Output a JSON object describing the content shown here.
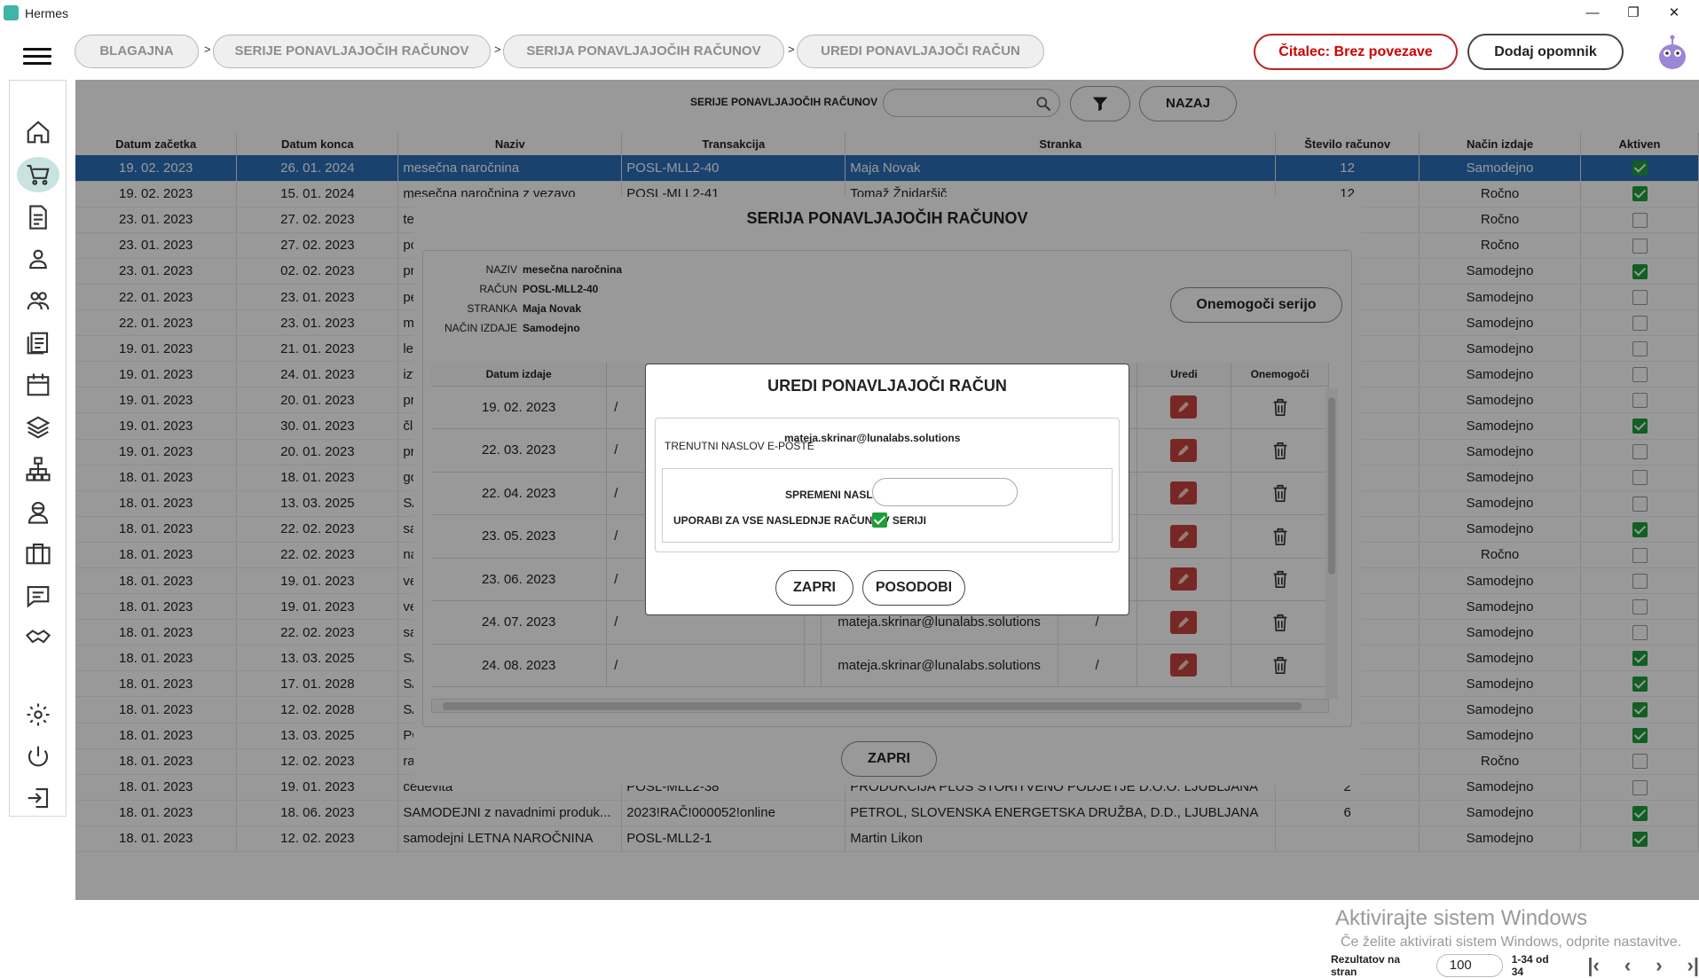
{
  "window": {
    "title": "Hermes",
    "minimize": "—",
    "maximize": "❐",
    "close": "✕"
  },
  "breadcrumbs": [
    "BLAGAJNA",
    "SERIJE PONAVLJAJOČIH RAČUNOV",
    "SERIJA PONAVLJAJOČIH RAČUNOV",
    "UREDI PONAVLJAJOČI RAČUN"
  ],
  "breadcrumb_separator": ">",
  "header": {
    "reader_status": "Čitalec: Brez povezave",
    "add_reminder": "Dodaj opomnik"
  },
  "sidebar": {
    "items": [
      "home-icon",
      "cart-icon",
      "document-icon",
      "user-icon",
      "users-icon",
      "notes-icon",
      "calendar-icon",
      "layers-icon",
      "network-icon",
      "support-icon",
      "briefcase-icon",
      "chat-icon",
      "handshake-icon",
      "settings-icon",
      "power-icon",
      "logout-icon"
    ],
    "active": "cart-icon"
  },
  "toolbar": {
    "filter_label": "SERIJE PONAVLJAJOČIH RAČUNOV",
    "search_placeholder": "",
    "back_label": "NAZAJ"
  },
  "table": {
    "columns": [
      "Datum začetka",
      "Datum konca",
      "Naziv",
      "Transakcija",
      "Stranka",
      "Število računov",
      "Način izdaje",
      "Aktiven"
    ],
    "rows": [
      [
        "19. 02. 2023",
        "26. 01. 2024",
        "mesečna naročnina",
        "POSL-MLL2-40",
        "Maja Novak",
        "12",
        "Samodejno",
        true
      ],
      [
        "19. 02. 2023",
        "15. 01. 2024",
        "mesečna naročnina z vezavo",
        "POSL-MLL2-41",
        "Tomaž Žnidaršič",
        "12",
        "Ročno",
        true
      ],
      [
        "23. 01. 2023",
        "27. 02. 2023",
        "te",
        "",
        "",
        "",
        "Ročno",
        false
      ],
      [
        "23. 01. 2023",
        "27. 02. 2023",
        "po",
        "",
        "",
        "",
        "Ročno",
        false
      ],
      [
        "23. 01. 2023",
        "02. 02. 2023",
        "pr",
        "",
        "",
        "",
        "Samodejno",
        true
      ],
      [
        "22. 01. 2023",
        "23. 01. 2023",
        "pe",
        "",
        "",
        "",
        "Samodejno",
        false
      ],
      [
        "22. 01. 2023",
        "23. 01. 2023",
        "m",
        "",
        "",
        "",
        "Samodejno",
        false
      ],
      [
        "19. 01. 2023",
        "21. 01. 2023",
        "le",
        "",
        "",
        "",
        "Samodejno",
        false
      ],
      [
        "19. 01. 2023",
        "24. 01. 2023",
        "izv",
        "",
        "",
        "",
        "Samodejno",
        false
      ],
      [
        "19. 01. 2023",
        "20. 01. 2023",
        "pr",
        "",
        "",
        "",
        "Samodejno",
        false
      ],
      [
        "19. 01. 2023",
        "30. 01. 2023",
        "čla",
        "",
        "",
        "",
        "Samodejno",
        true
      ],
      [
        "19. 01. 2023",
        "20. 01. 2023",
        "pr",
        "",
        "",
        "",
        "Samodejno",
        false
      ],
      [
        "18. 01. 2023",
        "18. 01. 2023",
        "go",
        "",
        "",
        "",
        "Samodejno",
        false
      ],
      [
        "18. 01. 2023",
        "13. 03. 2025",
        "SA",
        "",
        "",
        "",
        "Samodejno",
        false
      ],
      [
        "18. 01. 2023",
        "22. 02. 2023",
        "sa",
        "",
        "",
        "",
        "Samodejno",
        true
      ],
      [
        "18. 01. 2023",
        "22. 02. 2023",
        "na",
        "",
        "",
        "",
        "Ročno",
        false
      ],
      [
        "18. 01. 2023",
        "19. 01. 2023",
        "ve",
        "",
        "",
        "",
        "Samodejno",
        false
      ],
      [
        "18. 01. 2023",
        "19. 01. 2023",
        "ve",
        "",
        "",
        "",
        "Samodejno",
        false
      ],
      [
        "18. 01. 2023",
        "22. 02. 2023",
        "sa",
        "",
        "",
        "",
        "Samodejno",
        false
      ],
      [
        "18. 01. 2023",
        "13. 03. 2025",
        "SA",
        "",
        "",
        "",
        "Samodejno",
        true
      ],
      [
        "18. 01. 2023",
        "17. 01. 2028",
        "SA",
        "",
        "",
        "",
        "Samodejno",
        true
      ],
      [
        "18. 01. 2023",
        "12. 02. 2028",
        "SA",
        "",
        "",
        "",
        "Samodejno",
        true
      ],
      [
        "18. 01. 2023",
        "13. 03. 2025",
        "PO",
        "",
        "",
        "",
        "Samodejno",
        true
      ],
      [
        "18. 01. 2023",
        "12. 02. 2023",
        "ra",
        "",
        "",
        "",
        "Ročno",
        false
      ],
      [
        "18. 01. 2023",
        "19. 01. 2023",
        "cedevita",
        "POSL-MLL2-38",
        "PRODUKCIJA PLUS STORITVENO PODJETJE D.O.O. LJUBLJANA",
        "2",
        "Samodejno",
        false
      ],
      [
        "18. 01. 2023",
        "18. 06. 2023",
        "SAMODEJNI z navadnimi produk...",
        "2023!RAČ!000052!online",
        "PETROL, SLOVENSKA ENERGETSKA DRUŽBA, D.D., LJUBLJANA",
        "6",
        "Samodejno",
        true
      ],
      [
        "18. 01. 2023",
        "12. 02. 2023",
        "samodejni LETNA NAROČNINA",
        "POSL-MLL2-1",
        "Martin Likon",
        "",
        "Samodejno",
        true
      ]
    ]
  },
  "pager": {
    "label": "Rezultatov na stran",
    "per_page": "100",
    "range": "1-34 od 34"
  },
  "watermark": {
    "line1": "Aktivirajte sistem Windows",
    "line2": "Če želite aktivirati sistem Windows, odprite nastavitve."
  },
  "series_modal": {
    "title": "SERIJA PONAVLJAJOČIH RAČUNOV",
    "info": [
      {
        "label": "NAZIV",
        "value": "mesečna naročnina"
      },
      {
        "label": "RAČUN",
        "value": "POSL-MLL2-40"
      },
      {
        "label": "STRANKA",
        "value": "Maja Novak"
      },
      {
        "label": "NAČIN IZDAJE",
        "value": "Samodejno"
      }
    ],
    "disable_label": "Onemogoči serijo",
    "columns": [
      "Datum izdaje",
      "",
      "",
      "",
      "",
      "Uredi",
      "Onemogoči"
    ],
    "rows": [
      [
        "19. 02. 2023",
        "/",
        "",
        "",
        ""
      ],
      [
        "22. 03. 2023",
        "/",
        "",
        "",
        ""
      ],
      [
        "22. 04. 2023",
        "/",
        "",
        "",
        ""
      ],
      [
        "23. 05. 2023",
        "/",
        "",
        "",
        ""
      ],
      [
        "23. 06. 2023",
        "/",
        "",
        "",
        ""
      ],
      [
        "24. 07. 2023",
        "/",
        "",
        "mateja.skrinar@lunalabs.solutions",
        "/"
      ],
      [
        "24. 08. 2023",
        "/",
        "",
        "mateja.skrinar@lunalabs.solutions",
        "/"
      ]
    ],
    "close_label": "ZAPRI"
  },
  "edit_modal": {
    "title": "UREDI PONAVLJAJOČI RAČUN",
    "current_label": "TRENUTNI NASLOV E-POŠTE",
    "current_value": "mateja.skrinar@lunalabs.solutions",
    "change_label": "SPREMENI NASLOV",
    "change_value": "",
    "use_all_label": "UPORABI ZA VSE NASLEDNJE RAČUNE V SERIJI",
    "use_all_checked": true,
    "close_label": "ZAPRI",
    "update_label": "POSODOBI"
  }
}
